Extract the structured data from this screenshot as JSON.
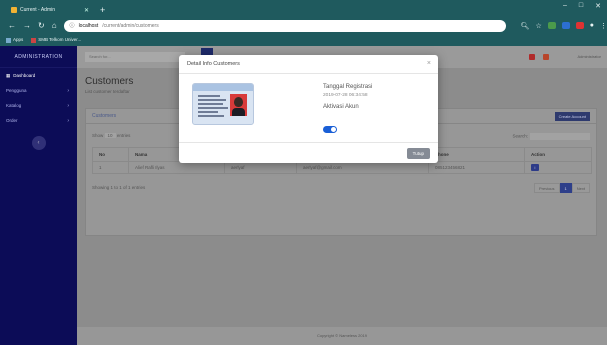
{
  "browser": {
    "tab_title": "Current - Admin",
    "new_tab_symbol": "+",
    "url_host": "localhost",
    "url_path": "/current/admin/customers",
    "bookmarks": [
      "Apps",
      "SMB Telkom Univer..."
    ],
    "win_min": "–",
    "win_max": "□",
    "win_close": "✕"
  },
  "sidebar": {
    "brand": "ADMINISTRATION",
    "items": [
      {
        "label": "Dashboard",
        "active": true,
        "has_arrow": false
      },
      {
        "label": "Pengguna",
        "active": false,
        "has_arrow": true
      },
      {
        "label": "Katalog",
        "active": false,
        "has_arrow": true
      },
      {
        "label": "Order",
        "active": false,
        "has_arrow": true
      }
    ],
    "toggle_symbol": "‹"
  },
  "topnav": {
    "search_placeholder": "Search for...",
    "user_label": "Administrator"
  },
  "page": {
    "title": "Customers",
    "subtitle": "List customer terdaftar"
  },
  "card": {
    "header": "Customers",
    "add_button": "Create Account",
    "show_label": "Show",
    "entries_value": "10",
    "entries_label": "entries",
    "search_label": "Search:",
    "columns": [
      "No",
      "Nama",
      "Username",
      "Email",
      "Phone",
      "Action"
    ],
    "rows": [
      {
        "no": "1",
        "nama": "Alief Rafli Ilyas",
        "username": "aerlyaf",
        "email": "aerlyaf@gmail.com",
        "phone": "085123456821",
        "action": "i"
      }
    ],
    "showing_text": "Showing 1 to 1 of 1 entries",
    "pager": {
      "prev": "Previous",
      "current": "1",
      "next": "Next"
    }
  },
  "footer": {
    "text": "Copyright © Nameless 2019"
  },
  "modal": {
    "title": "Detail Info Customers",
    "close_symbol": "×",
    "reg_label": "Tanggal Registrasi",
    "reg_value": "2019-07-28 06:34:58",
    "aktivasi_label": "Aktivasi Akun",
    "aktivasi_on": true,
    "close_button": "Tutup"
  },
  "colors": {
    "sidebar_bg": "#0c0c57",
    "primary": "#2e3f8a",
    "toggle": "#1a5fd6",
    "chrome": "#1f5a5e"
  }
}
